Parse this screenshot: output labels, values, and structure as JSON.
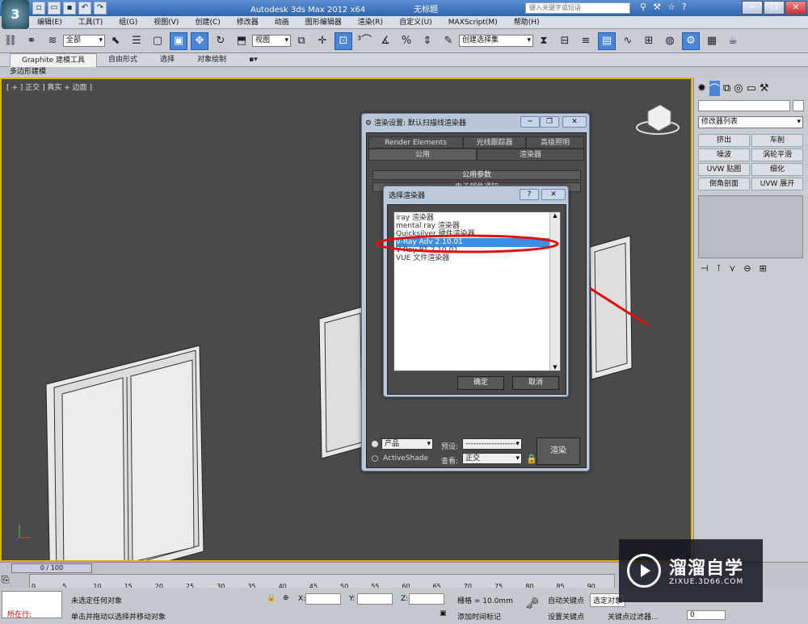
{
  "window": {
    "app_title": "Autodesk 3ds Max  2012 x64",
    "doc_title": "无标题",
    "search_placeholder": "键入关键字或短语",
    "logo_text": "3",
    "minimize": "─",
    "restore": "❐",
    "close": "✕"
  },
  "menu": [
    "编辑(E)",
    "工具(T)",
    "组(G)",
    "视图(V)",
    "创建(C)",
    "修改器",
    "动画",
    "图形编辑器",
    "渲染(R)",
    "自定义(U)",
    "MAXScript(M)",
    "帮助(H)"
  ],
  "toolbar": {
    "selection_filter": "全部",
    "reference_coord": "视图",
    "named_selection": "创建选择集"
  },
  "ribbon": {
    "tabs": [
      "Graphite 建模工具",
      "自由形式",
      "选择",
      "对象绘制"
    ],
    "sub": "多边形建模"
  },
  "viewport": {
    "label": "[ + ] 正交 ] 真实 + 边面 ]"
  },
  "command_panel": {
    "modifier_list": "修改器列表",
    "buttons": [
      "挤出",
      "车削",
      "噪波",
      "涡轮平滑",
      "UVW 贴图",
      "细化",
      "倒角剖面",
      "UVW 展开"
    ]
  },
  "render_dialog": {
    "title": "渲染设置: 默认扫描线渲染器",
    "tabs_row1": [
      "Render Elements",
      "光线跟踪器",
      "高级照明"
    ],
    "tabs_row2": [
      "公用",
      "渲染器"
    ],
    "rollouts": [
      "公用参数",
      "电子邮件通知"
    ],
    "product_label": "产品",
    "activeshade_label": "ActiveShade",
    "preset_label": "预设:",
    "preset_value": "--------------------",
    "view_label": "查看:",
    "view_value": "正交",
    "render_button": "渲染"
  },
  "choose_dialog": {
    "title": "选择渲染器",
    "help": "?",
    "close": "✕",
    "items": [
      "iray 渲染器",
      "mental ray 渲染器",
      "Quicksilver 硬件渲染器",
      "V-Ray Adv 2.10.01",
      "V-Ray RT 2.10.01",
      "VUE 文件渲染器"
    ],
    "selected_index": 3,
    "ok": "确定",
    "cancel": "取消"
  },
  "timeline": {
    "slider_text": "0 / 100",
    "ticks": [
      "0",
      "5",
      "10",
      "15",
      "20",
      "25",
      "30",
      "35",
      "40",
      "45",
      "50",
      "55",
      "60",
      "65",
      "70",
      "75",
      "80",
      "85",
      "90"
    ]
  },
  "status": {
    "script_error": "所在行:",
    "line1": "未选定任何对象",
    "line2": "单击并拖动以选择并移动对象",
    "x_label": "X:",
    "y_label": "Y:",
    "z_label": "Z:",
    "grid": "栅格 = 10.0mm",
    "add_time_tag": "添加时间标记",
    "auto_key": "自动关键点",
    "selected": "选定对象",
    "set_key": "设置关键点",
    "key_filters": "关键点过滤器...",
    "frame": "0"
  },
  "watermark": {
    "brand": "溜溜自学",
    "url": "ZIXUE.3D66.COM"
  }
}
